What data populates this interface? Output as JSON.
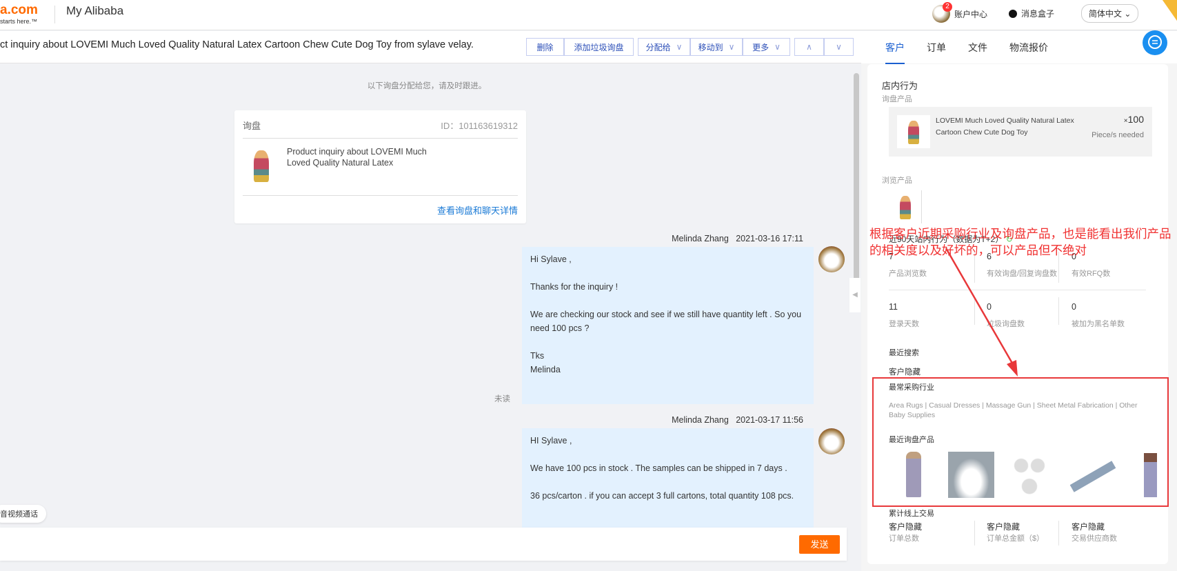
{
  "header": {
    "logo": "a.com",
    "logo_tag": "starts here.™",
    "title": "My Alibaba",
    "account_badge": "2",
    "account": "账户中心",
    "messages": "消息盒子",
    "language": "简体中文"
  },
  "toolbar": {
    "subject": "ct inquiry about LOVEMI Much Loved Quality Natural Latex Cartoon Chew Cute Dog Toy from sylave velay.",
    "delete": "删除",
    "add_spam": "添加垃圾询盘",
    "assign": "分配给",
    "move": "移动到",
    "more": "更多",
    "up": "∧",
    "down": "∨"
  },
  "chat": {
    "system_notice": "以下询盘分配给您，请及时跟进。",
    "inquiry_card": {
      "label": "询盘",
      "id": "ID：101163619312",
      "text": "Product inquiry about LOVEMI Much Loved Quality Natural Latex",
      "link": "查看询盘和聊天详情"
    },
    "messages": [
      {
        "sender": "Melinda Zhang",
        "time": "2021-03-16 17:11",
        "status": "未读",
        "lines": [
          "Hi Sylave ,",
          "",
          "Thanks for the inquiry !",
          "",
          "We are checking our stock and see if we still have quantity left .  So you need  100 pcs  ?",
          "",
          "Tks",
          "Melinda"
        ]
      },
      {
        "sender": "Melinda Zhang",
        "time": "2021-03-17 11:56",
        "lines": [
          "HI Sylave ,",
          "",
          "We  have 100 pcs in stock . The samples can be shipped in 7 days .",
          "",
          "36 pcs/carton .  if you can accept 3 full cartons, total quantity 108 pcs."
        ]
      }
    ],
    "av_call": "音视频通话",
    "send": "发送"
  },
  "right": {
    "tabs": [
      "客户",
      "订单",
      "文件",
      "物流报价"
    ],
    "store_behavior": "店内行为",
    "inquiry_product_label": "询盘产品",
    "inquiry_product": {
      "name": "LOVEMI Much Loved Quality Natural Latex Cartoon Chew Cute Dog Toy",
      "qty": "100",
      "qty_prefix": "×",
      "unit": "Piece/s needed"
    },
    "browsed_label": "浏览产品",
    "site_behavior": "近90天站内行为（数据为T+2）",
    "stats": [
      {
        "value": "7",
        "label": "产品浏览数"
      },
      {
        "value": "6",
        "label": "有效询盘/回复询盘数"
      },
      {
        "value": "0",
        "label": "有效RFQ数"
      },
      {
        "value": "11",
        "label": "登录天数"
      },
      {
        "value": "0",
        "label": "垃圾询盘数"
      },
      {
        "value": "0",
        "label": "被加为黑名单数"
      }
    ],
    "recent_search": "最近搜索",
    "recent_search_value": "客户隐藏",
    "top_industries_label": "最常采购行业",
    "top_industries": "Area Rugs | Casual Dresses | Massage Gun | Sheet Metal Fabrication | Other Baby Supplies",
    "recent_inquiry_label": "最近询盘产品",
    "online_trade_label": "累计线上交易",
    "trade": [
      {
        "value": "客户隐藏",
        "label": "订单总数"
      },
      {
        "value": "客户隐藏",
        "label": "订单总金额（$）"
      },
      {
        "value": "客户隐藏",
        "label": "交易供应商数"
      }
    ]
  },
  "annotation": "根据客户近期采购行业及询盘产品，也是能看出我们产品的相关度以及好坏的，可以产品但不绝对",
  "colors": {
    "accent": "#ff6a00",
    "link": "#1a7ad6",
    "annotation": "#f03030"
  }
}
